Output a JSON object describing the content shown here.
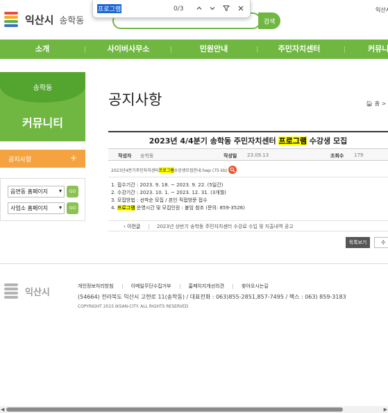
{
  "header": {
    "city_name": "익산시",
    "dong_name": "송학동",
    "search_button": "검색",
    "top_right": "익산시"
  },
  "findbar": {
    "query": "프로그램",
    "count": "0/3",
    "icons": [
      "chevron-up-icon",
      "chevron-down-icon",
      "filter-icon",
      "close-icon"
    ]
  },
  "nav": {
    "items": [
      "소개",
      "사이버사무소",
      "민원안내",
      "주민자치센터",
      "커뮤니"
    ]
  },
  "sidebar": {
    "dong": "송학동",
    "title": "커뮤니티",
    "menu_item": "공지사항",
    "menu_plus": "+",
    "selects": [
      {
        "value": "읍면동 홈페이지",
        "go": "GO"
      },
      {
        "value": "사업소 홈페이지",
        "go": "GO"
      }
    ]
  },
  "main": {
    "page_title": "공지사항",
    "breadcrumb": "홈 > 커",
    "post": {
      "title_pre": "2023년 4/4분기 송학동 주민자치센터 ",
      "title_hl": "프로그램",
      "title_post": " 수강생 모집",
      "author_label": "작성자",
      "author": "송학동",
      "date_label": "작성일",
      "date": "23.09.13",
      "views_label": "조회수",
      "views": "179",
      "attach_pre": "2023년4분기주민자치센터",
      "attach_hl": "프로그램",
      "attach_post": "수강생모집안내.hwp (75 kb)",
      "body": [
        "1. 접수기간 :  2023. 9. 18. ~ 2023. 9. 22. (5일간)",
        "2. 수강기간 :  2023. 10. 1. ~ 2023. 12. 31. (3개월)",
        "3. 모집방법 : 선착순 모집 / 본인 직접방문 접수"
      ],
      "body4_pre": "4. ",
      "body4_hl": "프로그램",
      "body4_post": " 운영시간 및 모집인원 : 붙임 참조 (문의: 859-3526)"
    },
    "prev": {
      "label": "이전글",
      "title": "2023년 상반기 송학동 주민자치센터 수강료 수입 및 지출내역 공고"
    },
    "list_button": "목록보기",
    "edit_button": "수"
  },
  "footer": {
    "city_name": "익산시",
    "links": [
      "개인정보처리방침",
      "이메일무단수집거부",
      "홈페이지개선의견",
      "찾아오시는길"
    ],
    "address": "(54664) 전라북도 익산시 고현로 11(송학동) / 대표전화 : 063)855-2851,857-7495 / 팩스 : 063) 859-3183",
    "copyright": "COPYRIGHT 2015 IKSAN-CITY. ALL RIGHTS RESERVED"
  },
  "colors": {
    "brand_green": "#6fb741",
    "side_orange": "#f4a340",
    "highlight": "#ffff00",
    "find_selection": "#1a66d4"
  }
}
